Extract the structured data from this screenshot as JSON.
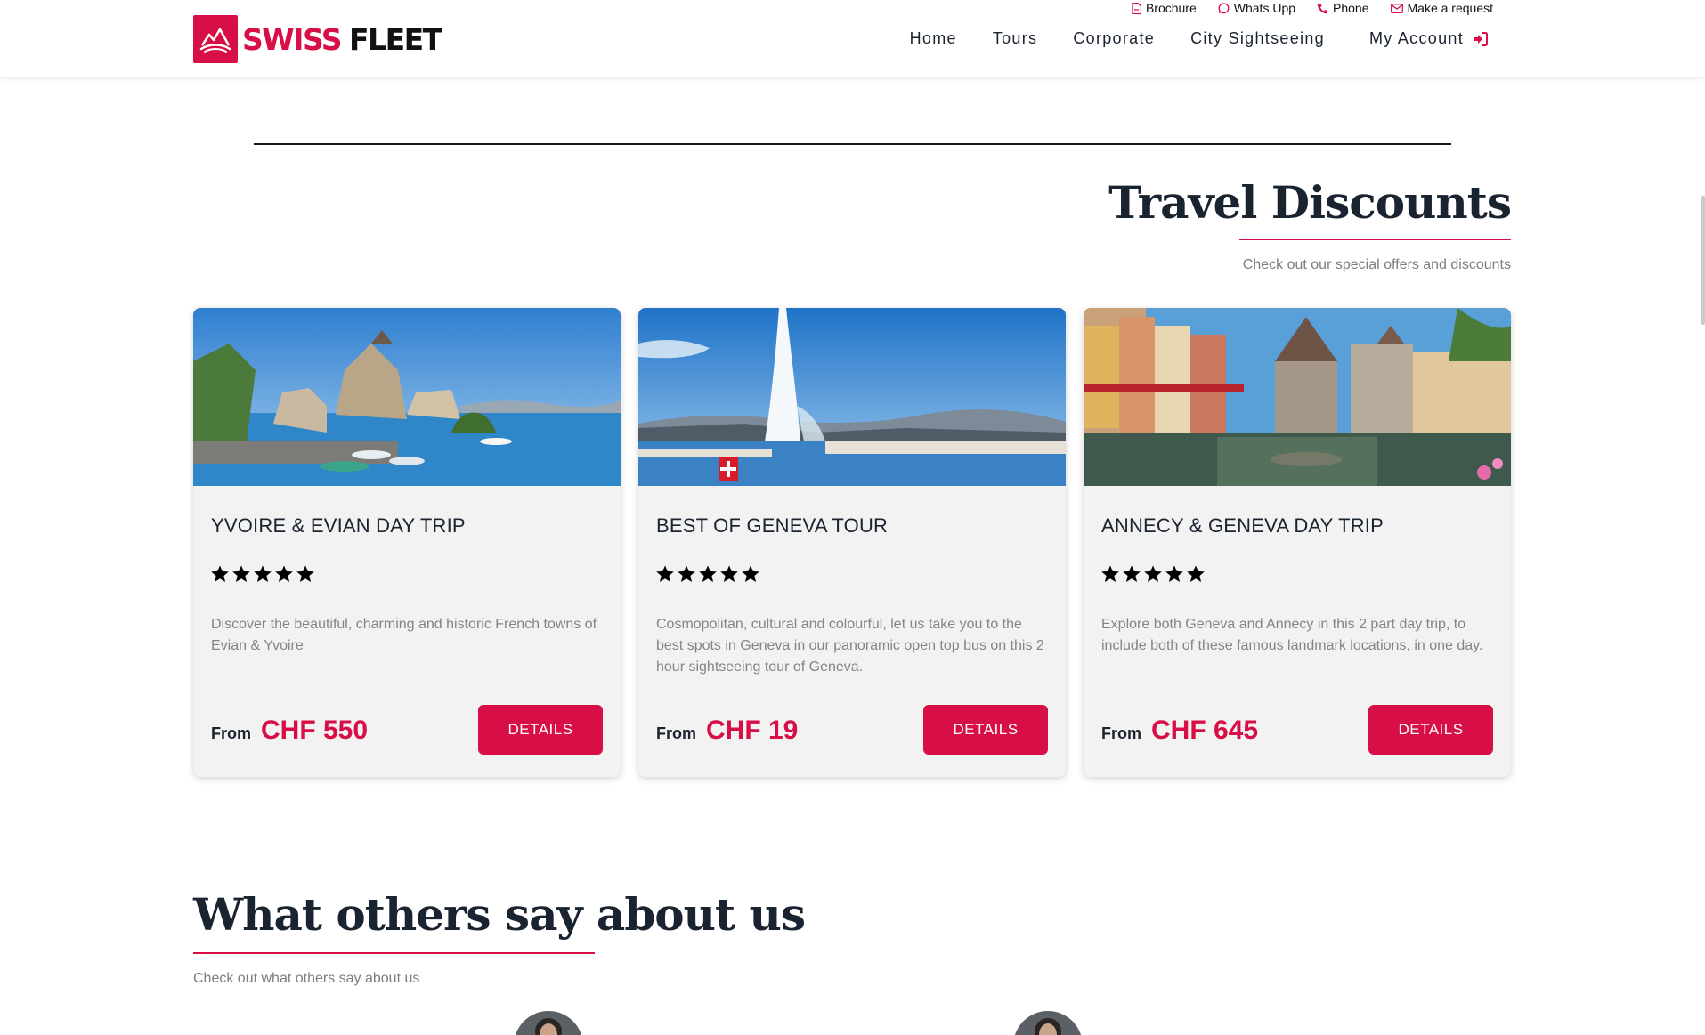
{
  "brand": {
    "name_part1": "SWISS",
    "name_part2": "FLEET",
    "accent_color": "#d80f46"
  },
  "toplinks": [
    {
      "label": "Brochure",
      "icon": "pdf-icon"
    },
    {
      "label": "Whats Upp",
      "icon": "whatsapp-icon"
    },
    {
      "label": "Phone",
      "icon": "phone-icon"
    },
    {
      "label": "Make a request",
      "icon": "envelope-icon"
    }
  ],
  "nav": {
    "items": [
      "Home",
      "Tours",
      "Corporate",
      "City Sightseeing"
    ],
    "account_label": "My Account",
    "account_icon": "sign-in-icon"
  },
  "discounts": {
    "title": "Travel Discounts",
    "subtitle": "Check out our special offers and discounts",
    "cards": [
      {
        "title": "YVOIRE & EVIAN DAY TRIP",
        "rating": 5,
        "description": "Discover the beautiful, charming and historic French towns of Evian & Yvoire",
        "from_label": "From",
        "price": "CHF 550",
        "button_label": "DETAILS",
        "image": "lakeside-village-photo"
      },
      {
        "title": "BEST OF GENEVA TOUR",
        "rating": 5,
        "description": "Cosmopolitan, cultural and colourful, let us take you to the best spots in Geneva in our panoramic open top bus on this 2 hour sightseeing tour of Geneva.",
        "from_label": "From",
        "price": "CHF 19",
        "button_label": "DETAILS",
        "image": "geneva-jet-deau-photo"
      },
      {
        "title": "ANNECY & GENEVA DAY TRIP",
        "rating": 5,
        "description": "Explore both Geneva and Annecy in this 2 part day trip, to include both of these famous landmark locations, in one day.",
        "from_label": "From",
        "price": "CHF 645",
        "button_label": "DETAILS",
        "image": "annecy-canal-photo"
      }
    ]
  },
  "testimonials": {
    "title": "What others say about us",
    "subtitle": "Check out what others say about us"
  }
}
